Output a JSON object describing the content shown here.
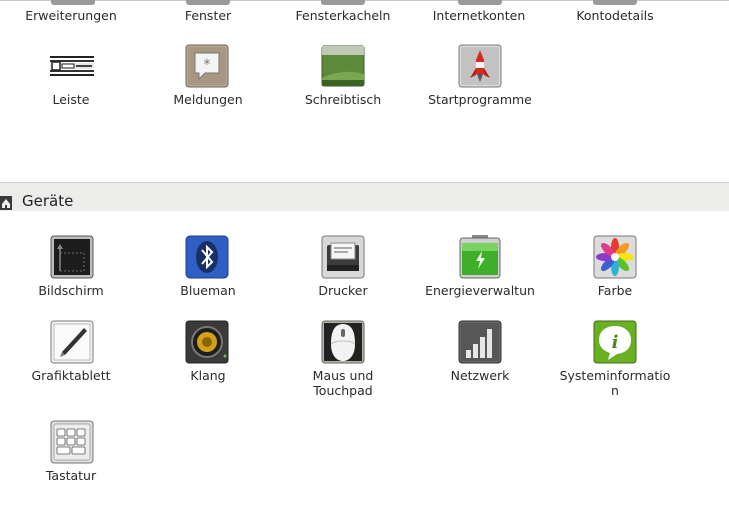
{
  "top_row": {
    "items": [
      {
        "label": "Erweiterungen"
      },
      {
        "label": "Fenster"
      },
      {
        "label": "Fensterkacheln"
      },
      {
        "label": "Internetkonten"
      },
      {
        "label": "Kontodetails"
      }
    ]
  },
  "personal": {
    "items": [
      {
        "label": "Leiste",
        "icon": "panel-icon"
      },
      {
        "label": "Meldungen",
        "icon": "notifications-icon"
      },
      {
        "label": "Schreibtisch",
        "icon": "desktop-icon"
      },
      {
        "label": "Startprogramme",
        "icon": "startup-rocket-icon"
      }
    ]
  },
  "devices": {
    "title": "Geräte",
    "items": [
      {
        "label": "Bildschirm",
        "icon": "display-icon"
      },
      {
        "label": "Blueman",
        "icon": "bluetooth-icon"
      },
      {
        "label": "Drucker",
        "icon": "printer-icon"
      },
      {
        "label": "Energieverwaltun",
        "icon": "battery-icon"
      },
      {
        "label": "Farbe",
        "icon": "color-icon"
      },
      {
        "label": "Grafiktablett",
        "icon": "tablet-icon"
      },
      {
        "label": "Klang",
        "icon": "speaker-icon"
      },
      {
        "label": "Maus und",
        "label2": "Touchpad",
        "icon": "mouse-icon"
      },
      {
        "label": "Netzwerk",
        "icon": "network-icon"
      },
      {
        "label": "Systeminformatio",
        "label2": "n",
        "icon": "info-icon"
      },
      {
        "label": "Tastatur",
        "icon": "keyboard-icon"
      }
    ]
  },
  "colors": {
    "section_bg": "#ececea",
    "bluetooth": "#2f5fc4",
    "battery": "#3fae2a",
    "info": "#6ab023"
  }
}
